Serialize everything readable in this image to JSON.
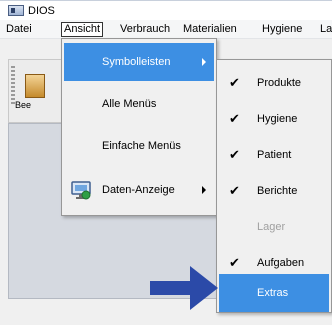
{
  "window": {
    "title": "DIOS"
  },
  "menubar": {
    "items": [
      "Datei",
      "Ansicht",
      "Verbrauch",
      "Materialien",
      "Hygiene",
      "La"
    ]
  },
  "toolbar": {
    "tool_label": "Bee"
  },
  "menu_ansicht": {
    "items": [
      {
        "label": "Symbolleisten",
        "has_submenu": true,
        "highlighted": true
      },
      {
        "label": "Alle Menüs"
      },
      {
        "label": "Einfache Menüs"
      },
      {
        "label": "Daten-Anzeige",
        "has_submenu": true,
        "icon": "monitor-icon"
      }
    ]
  },
  "menu_symbolleisten": {
    "items": [
      {
        "label": "Produkte",
        "checked": true
      },
      {
        "label": "Hygiene",
        "checked": true
      },
      {
        "label": "Patient",
        "checked": true
      },
      {
        "label": "Berichte",
        "checked": true
      },
      {
        "label": "Lager",
        "checked": false,
        "disabled": true
      },
      {
        "label": "Aufgaben",
        "checked": true
      },
      {
        "label": "Extras",
        "checked": false,
        "highlighted": true
      }
    ]
  },
  "colors": {
    "highlight": "#3d8fe3",
    "arrow": "#2b4aa8"
  }
}
